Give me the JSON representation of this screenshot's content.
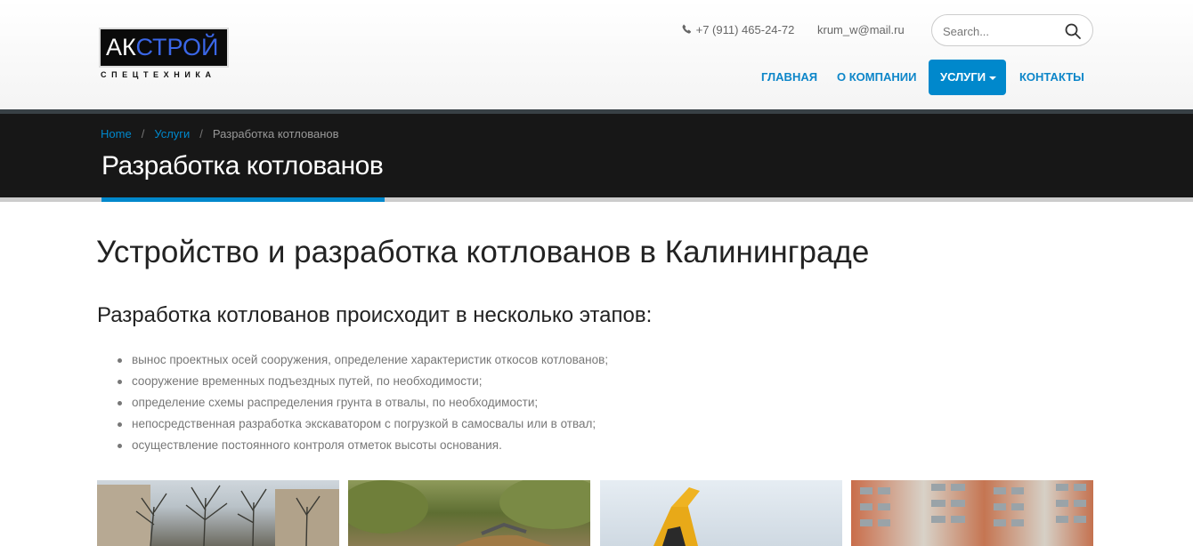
{
  "header": {
    "logo": {
      "main_left": "АК",
      "main_right": "СТРОЙ",
      "subtitle": "СПЕЦТЕХНИКА"
    },
    "phone": "+7 (911) 465-24-72",
    "email": "krum_w@mail.ru",
    "search": {
      "placeholder": "Search..."
    },
    "nav": {
      "home": "ГЛАВНАЯ",
      "about": "О КОМПАНИИ",
      "services": "УСЛУГИ",
      "contacts": "КОНТАКТЫ"
    }
  },
  "titlebar": {
    "breadcrumb": [
      "Home",
      "Услуги",
      "Разработка котлованов"
    ],
    "title": "Разработка котлованов"
  },
  "content": {
    "heading": "Устройство и разработка котлованов в Калининграде",
    "subheading": "Разработка котлованов происходит в несколько этапов:",
    "steps": [
      "вынос проектных осей сооружения, определение характеристик откосов котлованов;",
      "сооружение временных подъездных путей, по необходимости;",
      "определение схемы распределения грунта в отвалы, по необходимости;",
      "непосредственная разработка экскаватором с погрузкой в самосвалы или в отвал;",
      "осуществление постоянного контроля отметок высоты основания."
    ]
  },
  "colors": {
    "accent": "#0088cc",
    "titlebar_bg": "#171717",
    "logo_blue": "#3a66e6"
  }
}
